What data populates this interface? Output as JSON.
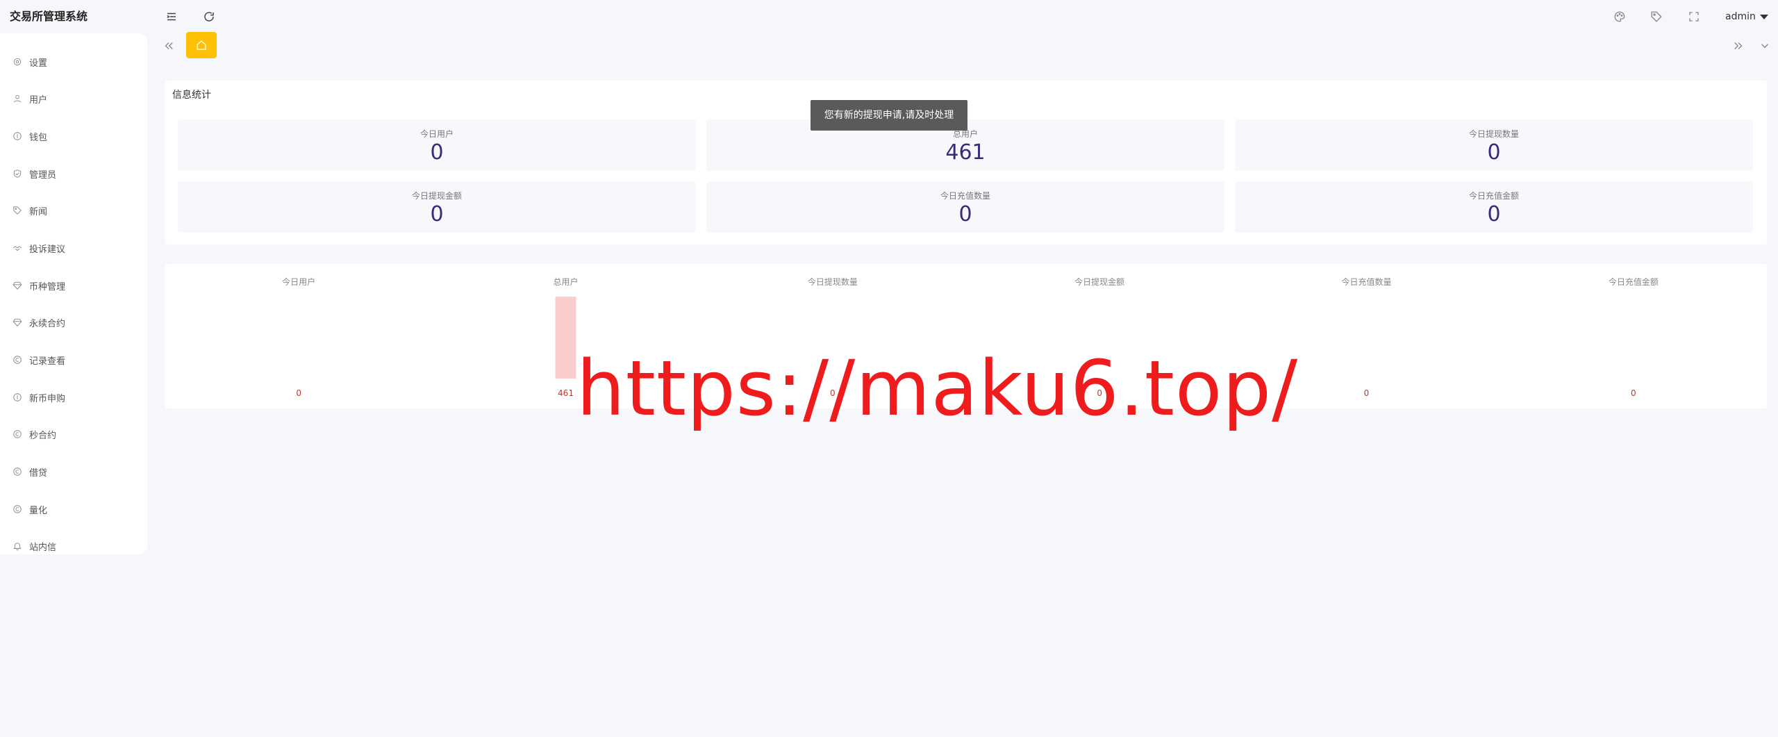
{
  "app": {
    "title": "交易所管理系统"
  },
  "sidebar": {
    "items": [
      {
        "label": "设置",
        "icon": "gear-icon"
      },
      {
        "label": "用户",
        "icon": "user-icon"
      },
      {
        "label": "钱包",
        "icon": "wallet-icon"
      },
      {
        "label": "管理员",
        "icon": "shield-icon"
      },
      {
        "label": "新闻",
        "icon": "tag-icon"
      },
      {
        "label": "投诉建议",
        "icon": "handshake-icon"
      },
      {
        "label": "币种管理",
        "icon": "gem-icon"
      },
      {
        "label": "永续合约",
        "icon": "gem-icon"
      },
      {
        "label": "记录查看",
        "icon": "coin-icon"
      },
      {
        "label": "新币申购",
        "icon": "coin-icon"
      },
      {
        "label": "秒合约",
        "icon": "coin-icon"
      },
      {
        "label": "借贷",
        "icon": "coin-icon"
      },
      {
        "label": "量化",
        "icon": "coin-icon"
      },
      {
        "label": "站内信",
        "icon": "bell-icon"
      }
    ]
  },
  "topbar": {
    "user": "admin"
  },
  "stats": {
    "title": "信息统计",
    "items": [
      {
        "label": "今日用户",
        "value": "0"
      },
      {
        "label": "总用户",
        "value": "461"
      },
      {
        "label": "今日提现数量",
        "value": "0"
      },
      {
        "label": "今日提现金额",
        "value": "0"
      },
      {
        "label": "今日充值数量",
        "value": "0"
      },
      {
        "label": "今日充值金额",
        "value": "0"
      }
    ]
  },
  "toast": {
    "message": "您有新的提现申请,请及时处理"
  },
  "chart_data": {
    "type": "bar",
    "categories": [
      "今日用户",
      "总用户",
      "今日提现数量",
      "今日提现金额",
      "今日充值数量",
      "今日充值金额"
    ],
    "values": [
      0,
      461,
      0,
      0,
      0,
      0
    ],
    "value_labels": [
      "0",
      "461",
      "0",
      "0",
      "0",
      "0"
    ],
    "bar_color": "#fbcccc",
    "label_color": "#c0392b"
  },
  "watermark": {
    "text": "https://maku6.top/"
  }
}
